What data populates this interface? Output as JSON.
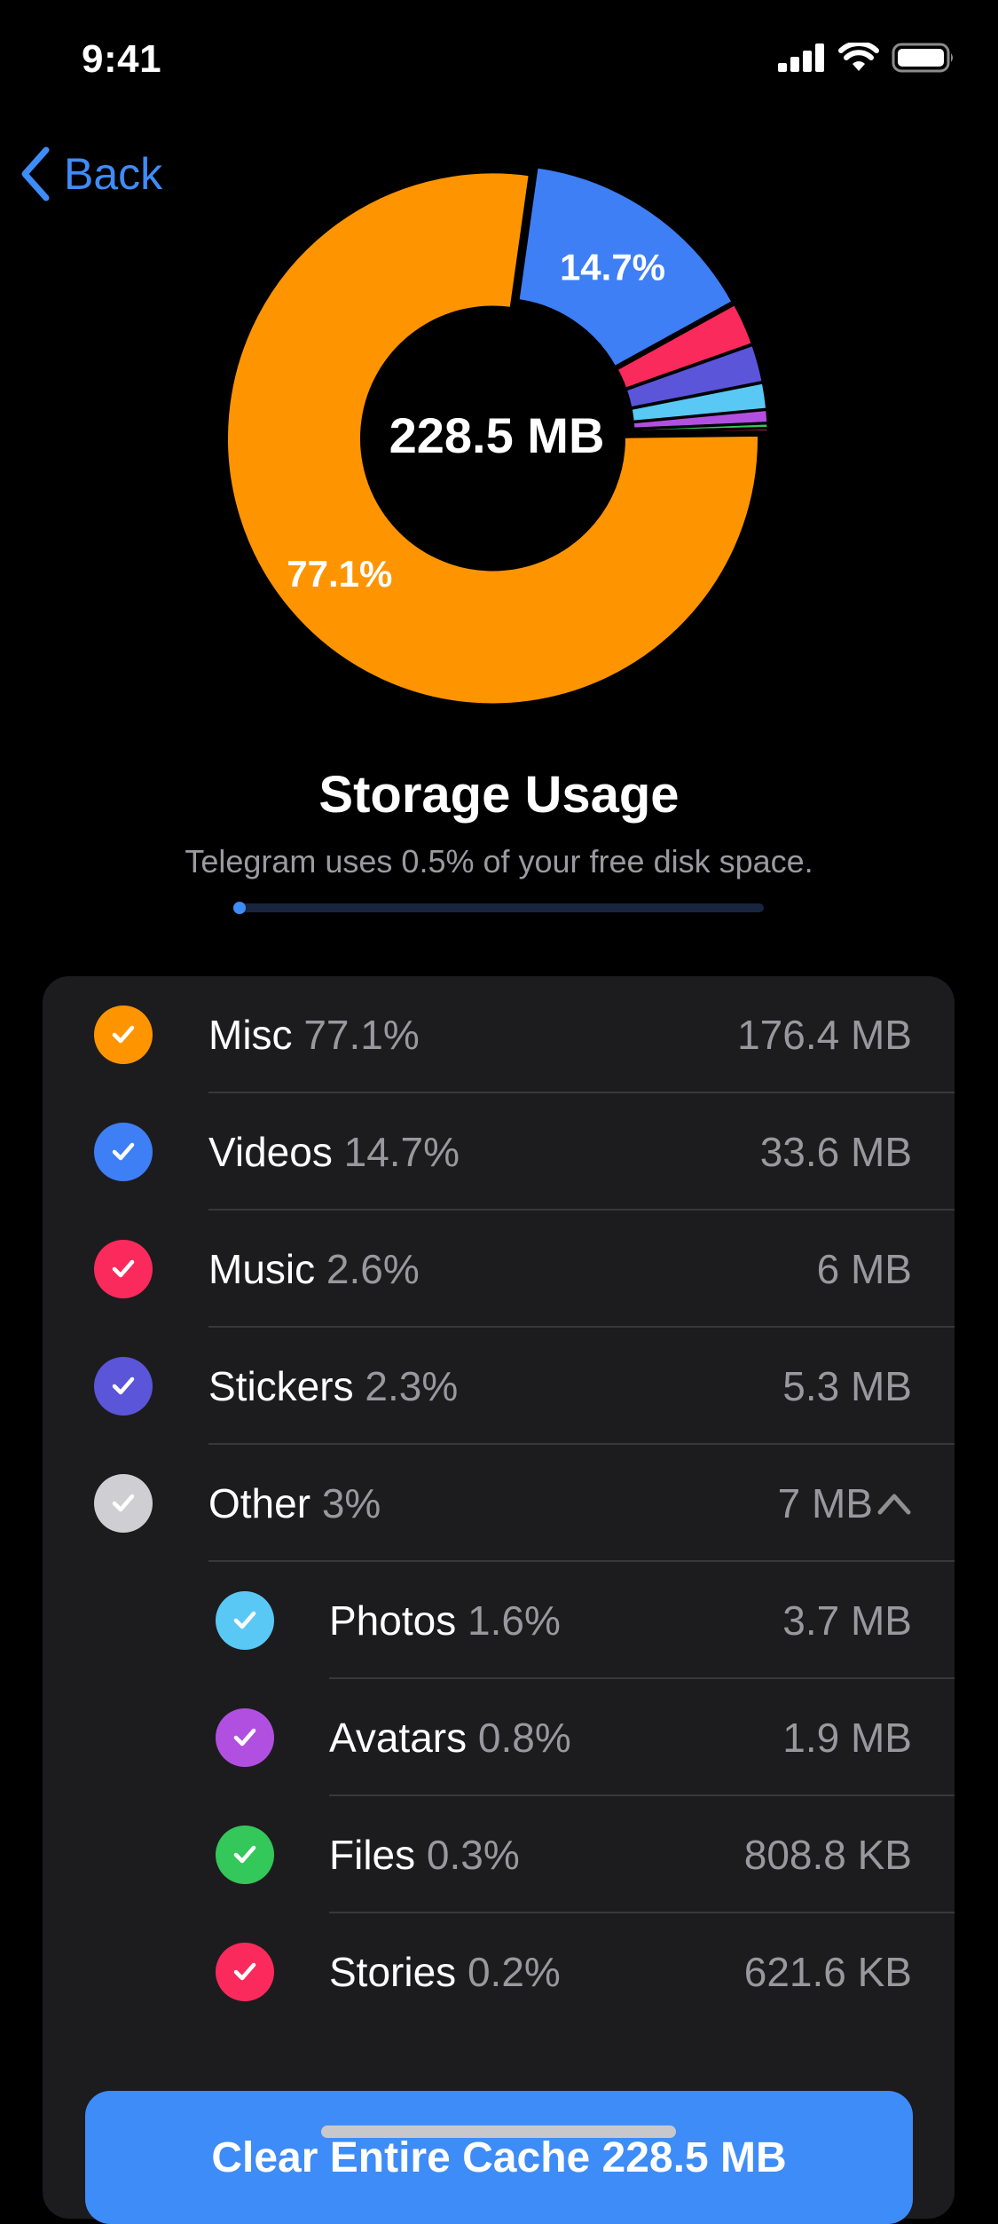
{
  "status_bar": {
    "time": "9:41"
  },
  "nav": {
    "back_label": "Back"
  },
  "chart_data": {
    "type": "pie",
    "center_label": "228.5 MB",
    "slices": [
      {
        "name": "Videos",
        "percent": 14.7,
        "label": "14.7%",
        "color": "#3e7ff6"
      },
      {
        "name": "Music",
        "percent": 2.6,
        "label": "",
        "color": "#fb2a5c"
      },
      {
        "name": "Stickers",
        "percent": 2.3,
        "label": "",
        "color": "#5a55d9"
      },
      {
        "name": "Photos",
        "percent": 1.6,
        "label": "",
        "color": "#5ac8f5"
      },
      {
        "name": "Avatars",
        "percent": 0.8,
        "label": "",
        "color": "#b150e0"
      },
      {
        "name": "Files",
        "percent": 0.3,
        "label": "",
        "color": "#34c759"
      },
      {
        "name": "Stories",
        "percent": 0.2,
        "label": "",
        "color": "#fb2a5c"
      },
      {
        "name": "Misc",
        "percent": 77.1,
        "label": "77.1%",
        "color": "#fe9500"
      }
    ]
  },
  "header": {
    "title": "Storage Usage",
    "subtitle": "Telegram uses 0.5% of your free disk space.",
    "usage_fraction": 0.005
  },
  "categories": [
    {
      "name": "Misc",
      "percent": "77.1%",
      "size": "176.4 MB",
      "color": "#fe9500"
    },
    {
      "name": "Videos",
      "percent": "14.7%",
      "size": "33.6 MB",
      "color": "#3e7ff6"
    },
    {
      "name": "Music",
      "percent": "2.6%",
      "size": "6 MB",
      "color": "#fb2a5c"
    },
    {
      "name": "Stickers",
      "percent": "2.3%",
      "size": "5.3 MB",
      "color": "#5a55d9"
    },
    {
      "name": "Other",
      "percent": "3%",
      "size": "7 MB",
      "color": "#cfcfd3"
    }
  ],
  "other_items": [
    {
      "name": "Photos",
      "percent": "1.6%",
      "size": "3.7 MB",
      "color": "#5ac8f5"
    },
    {
      "name": "Avatars",
      "percent": "0.8%",
      "size": "1.9 MB",
      "color": "#b150e0"
    },
    {
      "name": "Files",
      "percent": "0.3%",
      "size": "808.8 KB",
      "color": "#34c759"
    },
    {
      "name": "Stories",
      "percent": "0.2%",
      "size": "621.6 KB",
      "color": "#fb2a5c"
    }
  ],
  "clear_button": {
    "label": "Clear Entire Cache 228.5 MB"
  }
}
